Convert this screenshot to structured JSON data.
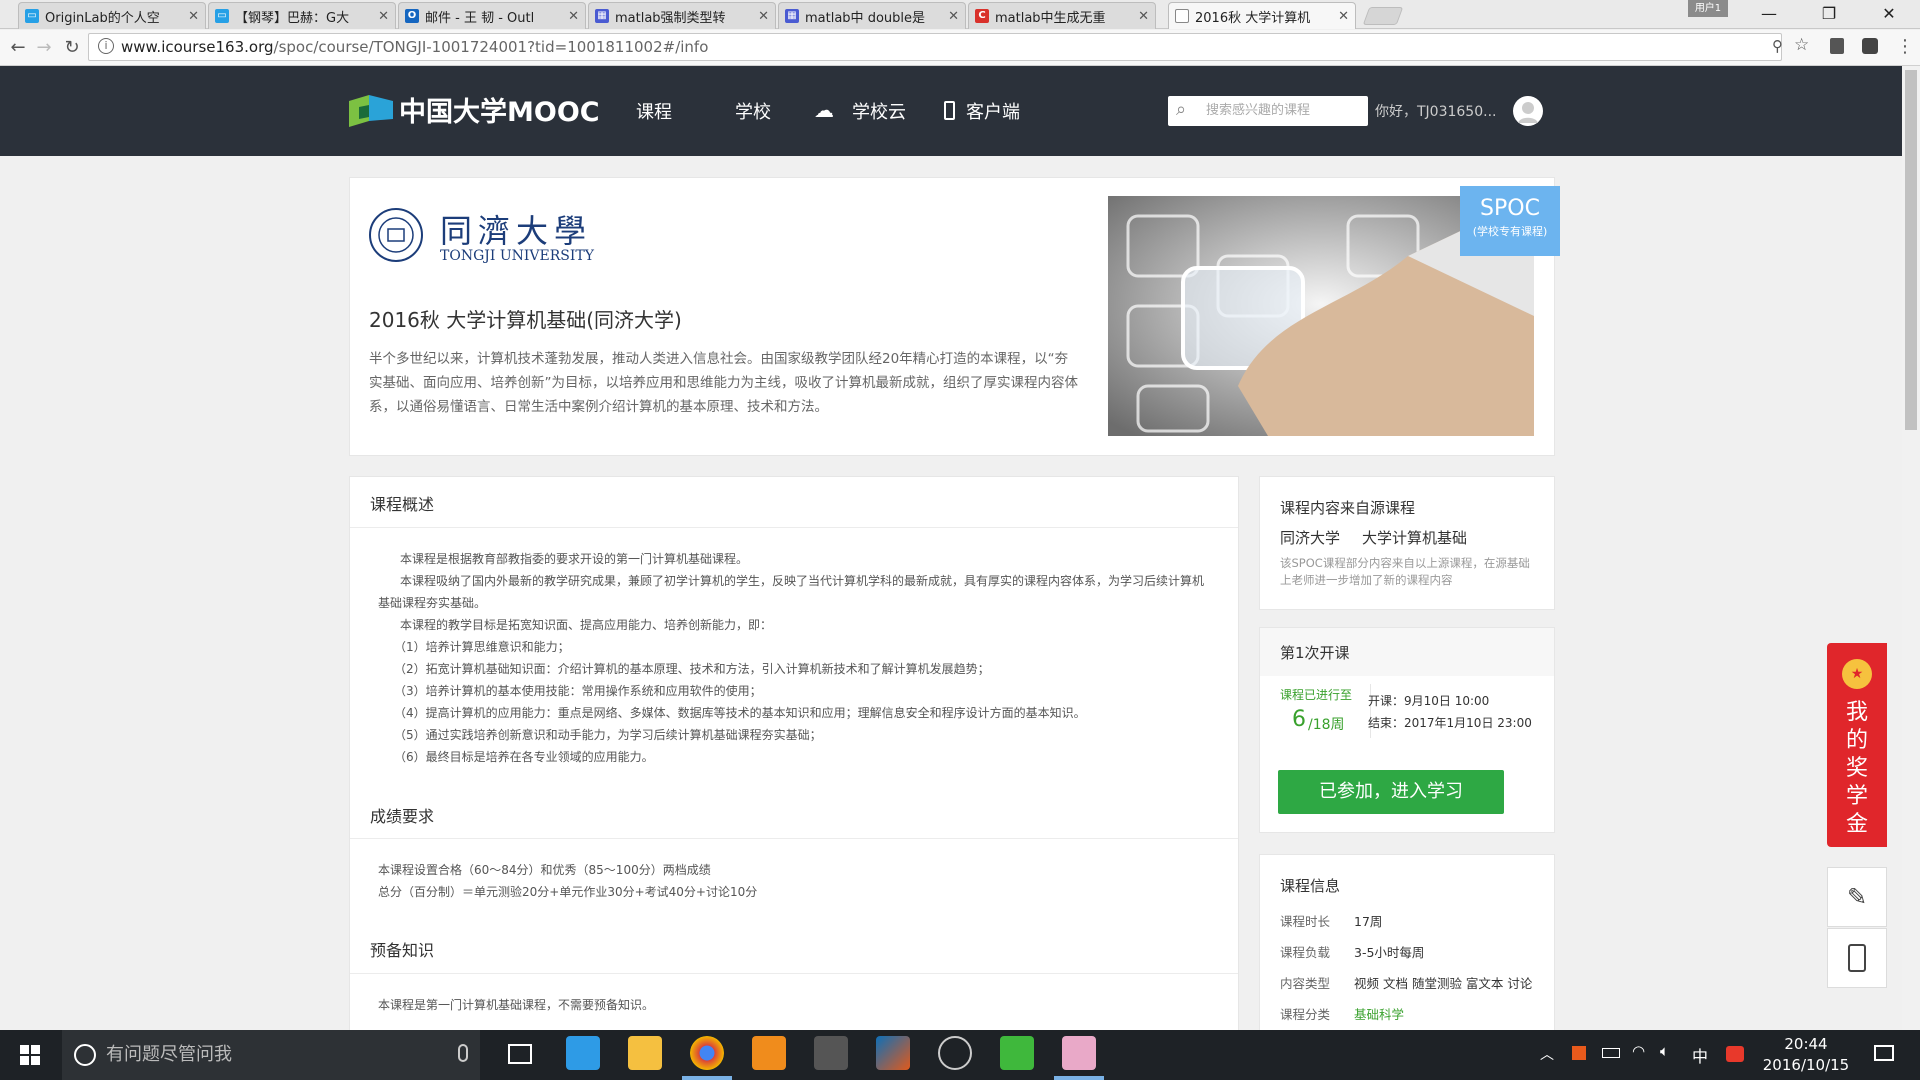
{
  "browser": {
    "tabs": [
      {
        "title": "OriginLab的个人空",
        "fav_color": "#26a0e6",
        "fav_glyph": "tv"
      },
      {
        "title": "【钢琴】巴赫：G大",
        "fav_color": "#26a0e6",
        "fav_glyph": "tv"
      },
      {
        "title": "邮件 - 王 韧 - Outl",
        "fav_color": "#1566c0",
        "fav_glyph": "O"
      },
      {
        "title": "matlab强制类型转",
        "fav_color": "#4a5bd2",
        "fav_glyph": "img"
      },
      {
        "title": "matlab中 double是",
        "fav_color": "#4a5bd2",
        "fav_glyph": "img"
      },
      {
        "title": "matlab中生成无重",
        "fav_color": "#d9312b",
        "fav_glyph": "C"
      },
      {
        "title": "2016秋 大学计算机",
        "fav_color": "#888888",
        "fav_glyph": "doc"
      }
    ],
    "user_badge": "用户1",
    "url_host": "www.icourse163.org",
    "url_path": "/spoc/course/TONGJI-1001724001?tid=1001811002#/info"
  },
  "site": {
    "logo_text": "中国大学MOOC",
    "nav": [
      "课程",
      "学校",
      "学校云",
      "客户端"
    ],
    "search_placeholder": "搜索感兴趣的课程",
    "greeting": "你好，TJ031650..."
  },
  "hero": {
    "university_cn": "同濟大學",
    "university_en": "TONGJI UNIVERSITY",
    "title": "2016秋 大学计算机基础(同济大学)",
    "description": "半个多世纪以来，计算机技术蓬勃发展，推动人类进入信息社会。由国家级教学团队经20年精心打造的本课程，以“夯实基础、面向应用、培养创新”为目标，以培养应用和思维能力为主线，吸收了计算机最新成就，组织了厚实课程内容体系，以通俗易懂语言、日常生活中案例介绍计算机的基本原理、技术和方法。",
    "badge_title": "SPOC",
    "badge_sub": "(学校专有课程)"
  },
  "overview": {
    "heading": "课程概述",
    "lines": [
      "本课程是根据教育部教指委的要求开设的第一门计算机基础课程。",
      "本课程吸纳了国内外最新的教学研究成果，兼顾了初学计算机的学生，反映了当代计算机学科的最新成就，具有厚实的课程内容体系，为学习后续计算机",
      "基础课程夯实基础。",
      "本课程的教学目标是拓宽知识面、提高应用能力、培养创新能力，即：",
      "（1）培养计算思维意识和能力；",
      "（2）拓宽计算机基础知识面：介绍计算机的基本原理、技术和方法，引入计算机新技术和了解计算机发展趋势；",
      "（3）培养计算机的基本使用技能：常用操作系统和应用软件的使用；",
      "（4）提高计算机的应用能力：重点是网络、多媒体、数据库等技术的基本知识和应用；理解信息安全和程序设计方面的基本知识。",
      "（5）通过实践培养创新意识和动手能力，为学习后续计算机基础课程夯实基础；",
      "（6）最终目标是培养在各专业领域的应用能力。"
    ]
  },
  "grading": {
    "heading": "成绩要求",
    "lines": [
      "本课程设置合格（60～84分）和优秀（85～100分）两档成绩",
      "总分（百分制）＝单元测验20分+单元作业30分+考试40分+讨论10分"
    ]
  },
  "prereq": {
    "heading": "预备知识",
    "line": "本课程是第一门计算机基础课程，不需要预备知识。"
  },
  "source": {
    "heading": "课程内容来自源课程",
    "university": "同济大学",
    "course": "大学计算机基础",
    "note": "该SPOC课程部分内容来自以上源课程，在源基础上老师进一步增加了新的课程内容"
  },
  "session": {
    "heading": "第1次开课",
    "progress_label": "课程已进行至",
    "week_current": "6",
    "week_total": "/18周",
    "start": "开课：9月10日 10:00",
    "end": "结束：2017年1月10日 23:00",
    "enter_button": "已参加，进入学习"
  },
  "info": {
    "heading": "课程信息",
    "rows": [
      {
        "k": "课程时长",
        "v": "17周"
      },
      {
        "k": "课程负载",
        "v": "3-5小时每周"
      },
      {
        "k": "内容类型",
        "v": "视频 文档 随堂测验 富文本 讨论"
      },
      {
        "k": "课程分类",
        "v": "基础科学"
      }
    ]
  },
  "float": {
    "reward_text": "我的奖学金"
  },
  "taskbar": {
    "search_placeholder": "有问题尽管问我",
    "ime": "中",
    "time": "20:44",
    "date": "2016/10/15"
  },
  "colors": {
    "header_bg": "#2b313a",
    "accent_green": "#2ea844",
    "spoc_blue": "#6cb4ef",
    "reward_red": "#e0262b"
  }
}
